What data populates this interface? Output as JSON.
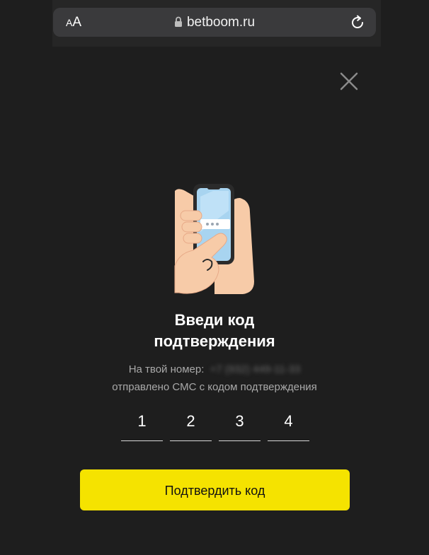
{
  "browser": {
    "text_size_label_small": "A",
    "text_size_label_large": "A",
    "url": "betboom.ru",
    "lock_icon": "lock-icon",
    "reload_icon": "reload-icon"
  },
  "dialog": {
    "close_icon": "close-icon",
    "illustration": "hand-holding-phone-illustration",
    "title_line1": "Введи код",
    "title_line2": "подтверждения",
    "subtitle_prefix": "На твой номер:",
    "phone_number": "+7 (932) 449-11-33",
    "subtitle_line2": "отправлено СМС с кодом подтверждения",
    "code_digits": [
      "1",
      "2",
      "3",
      "4"
    ],
    "confirm_label": "Подтвердить код"
  },
  "colors": {
    "background": "#1e1e1e",
    "accent": "#f5e300",
    "text_secondary": "#a9a9a9"
  }
}
